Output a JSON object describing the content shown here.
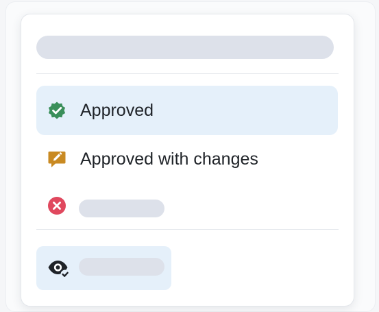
{
  "menu": {
    "search_placeholder": "",
    "items": [
      {
        "label": "Approved",
        "icon": "verified-check-icon",
        "icon_color": "#3a8f5a",
        "selected": true
      },
      {
        "label": "Approved with changes",
        "icon": "edit-comment-icon",
        "icon_color": "#c98a22",
        "selected": false
      },
      {
        "label": "",
        "icon": "x-circle-icon",
        "icon_color": "#e0485e",
        "selected": false
      }
    ],
    "watch": {
      "label": "",
      "icon": "eye-check-icon",
      "icon_color": "#1f2328"
    }
  },
  "colors": {
    "selected_bg": "#e5f0fa",
    "skeleton": "#dde1ea",
    "text": "#1f2328"
  }
}
